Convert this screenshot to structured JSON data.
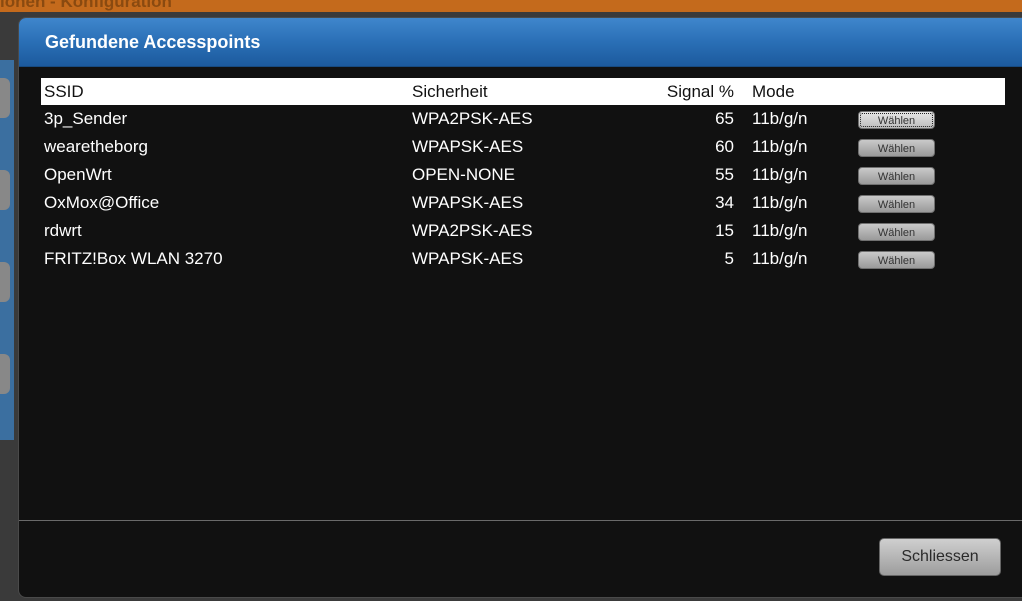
{
  "background": {
    "header_text": "ionen - Konfiguration"
  },
  "dialog": {
    "title": "Gefundene Accesspoints",
    "close_label": "Schliessen"
  },
  "table": {
    "headers": {
      "ssid": "SSID",
      "security": "Sicherheit",
      "signal": "Signal %",
      "mode": "Mode"
    },
    "rows": [
      {
        "ssid": "3p_Sender",
        "security": "WPA2PSK-AES",
        "signal": "65",
        "mode": "11b/g/n",
        "action": "Wählen"
      },
      {
        "ssid": "wearetheborg",
        "security": "WPAPSK-AES",
        "signal": "60",
        "mode": "11b/g/n",
        "action": "Wählen"
      },
      {
        "ssid": "OpenWrt",
        "security": "OPEN-NONE",
        "signal": "55",
        "mode": "11b/g/n",
        "action": "Wählen"
      },
      {
        "ssid": "OxMox@Office",
        "security": "WPAPSK-AES",
        "signal": "34",
        "mode": "11b/g/n",
        "action": "Wählen"
      },
      {
        "ssid": "rdwrt",
        "security": "WPA2PSK-AES",
        "signal": "15",
        "mode": "11b/g/n",
        "action": "Wählen"
      },
      {
        "ssid": "FRITZ!Box WLAN 3270",
        "security": "WPAPSK-AES",
        "signal": "5",
        "mode": "11b/g/n",
        "action": "Wählen"
      }
    ]
  },
  "colors": {
    "title_bar": "#2a6fb6",
    "dialog_bg": "#111111",
    "header_row_bg": "#ffffff"
  }
}
